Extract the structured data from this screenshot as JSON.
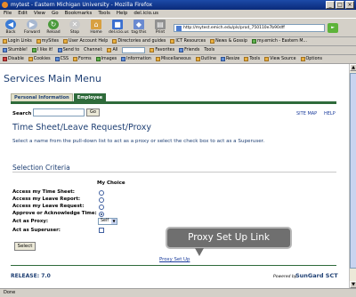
{
  "window": {
    "title": "mytest - Eastern Michigan University - Mozilla Firefox",
    "controls": [
      "_",
      "□",
      "×"
    ]
  },
  "menu": [
    "File",
    "Edit",
    "View",
    "Go",
    "Bookmarks",
    "Tools",
    "Help",
    "del.icio.us"
  ],
  "nav": {
    "buttons": [
      "Back",
      "Forward",
      "Reload",
      "Stop",
      "Home",
      "del.icio.us",
      "tag this",
      "Print"
    ],
    "url": "http://mytest.emich.edu/pls/prod_750110e7b90dff"
  },
  "bookmarks": [
    "Login Links",
    "mySites",
    "User Account Help",
    "Directories and guides",
    "ICT Resources",
    "News & Gossip",
    "my.emich - Eastern M..."
  ],
  "toolbar2": [
    "Stumble!",
    "I like it!",
    "Send to",
    "Channel:",
    "All",
    "Favorites",
    "Friends",
    "Tools"
  ],
  "toolbar3": [
    "Disable",
    "Cookies",
    "CSS",
    "Forms",
    "Images",
    "Information",
    "Miscellaneous",
    "Outline",
    "Resize",
    "Tools",
    "View Source",
    "Options"
  ],
  "page": {
    "main_title": "Services Main Menu",
    "tabs": [
      "Personal Information",
      "Employee"
    ],
    "search_label": "Search",
    "go_label": "Go",
    "site_map": "SITE MAP",
    "help": "HELP",
    "title": "Time Sheet/Leave Request/Proxy",
    "instruction": "Select a name from the pull-down list to act as a proxy or select the check box to act as a Superuser.",
    "section_title": "Selection Criteria",
    "choice_header": "My Choice",
    "criteria": [
      "Access my Time Sheet:",
      "Access my Leave Report:",
      "Access my Leave Request:",
      "Approve or Acknowledge Time:",
      "Act as Proxy:",
      "Act as Superuser:"
    ],
    "proxy_value": "Self",
    "select_button": "Select",
    "callout": "Proxy Set Up Link",
    "proxy_link": "Proxy Set Up",
    "release": "RELEASE: 7.0",
    "powered_by": "Powered by",
    "brand": "SunGard SCT"
  },
  "status": "Done"
}
